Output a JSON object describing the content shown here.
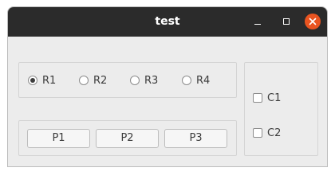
{
  "window": {
    "title": "test",
    "buttons": {
      "minimize_icon": "minimize-icon",
      "maximize_icon": "maximize-icon",
      "close_icon": "close-icon",
      "close_color": "#e95420"
    }
  },
  "radios": [
    {
      "label": "R1",
      "checked": true
    },
    {
      "label": "R2",
      "checked": false
    },
    {
      "label": "R3",
      "checked": false
    },
    {
      "label": "R4",
      "checked": false
    }
  ],
  "buttons": [
    {
      "label": "P1"
    },
    {
      "label": "P2"
    },
    {
      "label": "P3"
    }
  ],
  "checkboxes": [
    {
      "label": "C1",
      "checked": false
    },
    {
      "label": "C2",
      "checked": false
    }
  ]
}
